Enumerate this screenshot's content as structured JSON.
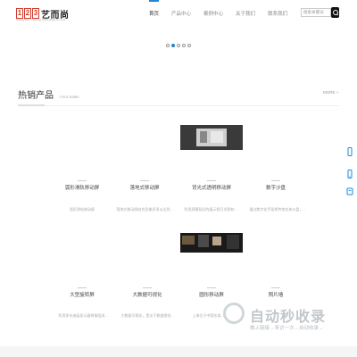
{
  "header": {
    "logo_digits": [
      "1",
      "2",
      "3"
    ],
    "logo_text": "艺而尚",
    "logo_sub": "Guangzhou Yierhang Technology Co.,Ltd",
    "nav": [
      {
        "label": "首页",
        "active": true
      },
      {
        "label": "产品中心",
        "active": false
      },
      {
        "label": "案例中心",
        "active": false
      },
      {
        "label": "关于我们",
        "active": false
      },
      {
        "label": "联系我们",
        "active": false
      }
    ],
    "search_placeholder": "搜索关键词",
    "accent": "#1e88d8"
  },
  "banner": {
    "dots": [
      false,
      true,
      false,
      false,
      false
    ]
  },
  "products": {
    "title": "热销产品",
    "subtitle": "/ Hot Sales",
    "more": "MORE +",
    "row1": [
      {
        "title": "弧形滑轨移动屏",
        "desc": "弧形滑轨移动屏"
      },
      {
        "title": "落地式移动屏",
        "desc": "落地式移动屏结合显像多项以达到..."
      },
      {
        "title": "背光式透明移动屏",
        "desc": "利用屏幕背后的展示柜灯光照射..."
      },
      {
        "title": "数字沙盘",
        "desc": "通过数字化手段将传统实体沙盘，..."
      }
    ],
    "row2": [
      {
        "title": "大型旋转屏",
        "desc": "利用多台液晶显示器拼接组成..."
      },
      {
        "title": "大数据可视化",
        "desc": "大数据可视化，是关于数据视觉..."
      },
      {
        "title": "圆形移动屏",
        "desc": "上海位于中国东部..."
      },
      {
        "title": "照片墙",
        "desc": ""
      }
    ]
  },
  "watermark": {
    "text": "自动秒收录",
    "sub": "做上链接→来访一次→自动收录→"
  }
}
